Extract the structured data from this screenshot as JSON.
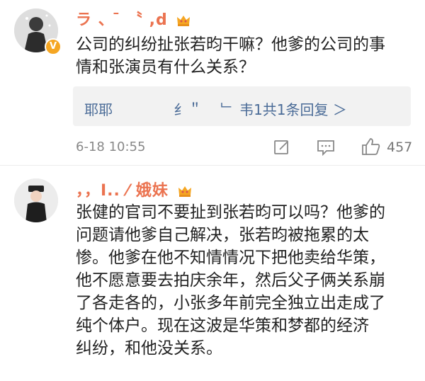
{
  "comments": [
    {
      "username": "ラ 、 ̄ 〝 ,d",
      "lines": [
        "公司的纠纷扯张若昀干嘛？他爹的公司的事",
        "情和张演员有什么关系？"
      ],
      "reply_summary": "耶耶　　　　 纟＂　  ﹂ 韦1共1条回复 ＞",
      "timestamp": "6-18 10:55",
      "like_count": "457"
    },
    {
      "username": "，，Ⅰ..  ⁄ 娥妹",
      "lines": [
        "张健的官司不要扯到张若昀可以吗？他爹的",
        "问题请他爹自己解决，张若昀被拖累的太",
        "惨。他爹在他不知情情况下把他卖给华策，",
        "他不愿意要去拍庆余年，然后父子俩关系崩",
        "了各走各的，小张多年前完全独立出走成了",
        "纯个体户。现在这波是华策和梦都的经济",
        "纠纷，和他没关系。"
      ]
    }
  ],
  "colors": {
    "username": "#eb7350",
    "reply_link": "#4a6b97",
    "meta": "#888888",
    "badge": "#f5a623"
  },
  "icons": [
    "avatar",
    "verified-badge-icon",
    "vip-crown-icon",
    "edit-icon",
    "comment-icon",
    "like-icon"
  ]
}
